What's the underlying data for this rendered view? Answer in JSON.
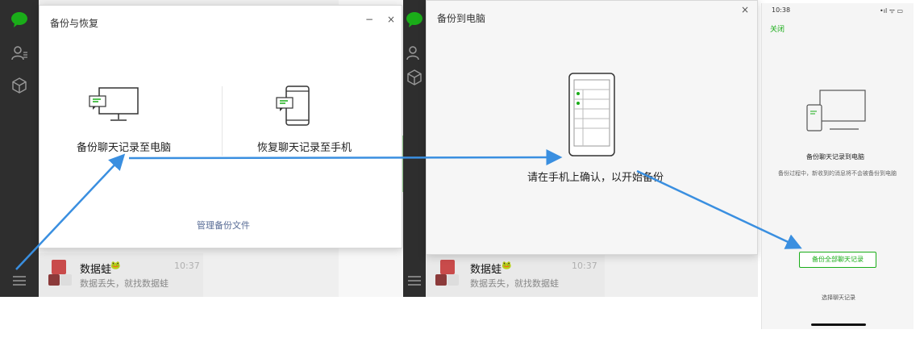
{
  "left_window": {
    "dialog_title": "备份与恢复",
    "minimize_glyph": "−",
    "close_glyph": "×",
    "backup_option_label": "备份聊天记录至电脑",
    "restore_option_label": "恢复聊天记录至手机",
    "manage_link": "管理备份文件",
    "chat": {
      "name": "数据蛙",
      "time": "10:37",
      "message": "数据丢失，就找数据蛙"
    }
  },
  "middle_window": {
    "dialog_title": "备份到电脑",
    "close_glyph": "×",
    "prompt": "请在手机上确认，以开始备份",
    "chat": {
      "name": "数据蛙",
      "time": "10:37",
      "message": "数据丢失，就找数据蛙"
    }
  },
  "phone": {
    "time": "10:38",
    "status_icons": "•ıl ᯤ ▭",
    "close_label": "关闭",
    "heading": "备份聊天记录到电脑",
    "description": "备份过程中，新收到的消息将不会被备份到电脑",
    "primary_button": "备份全部聊天记录",
    "secondary_link": "选择聊天记录"
  },
  "colors": {
    "accent_green": "#1aad19",
    "arrow_blue": "#3a8fe0",
    "sidebar_dark": "#2e2e2e"
  }
}
